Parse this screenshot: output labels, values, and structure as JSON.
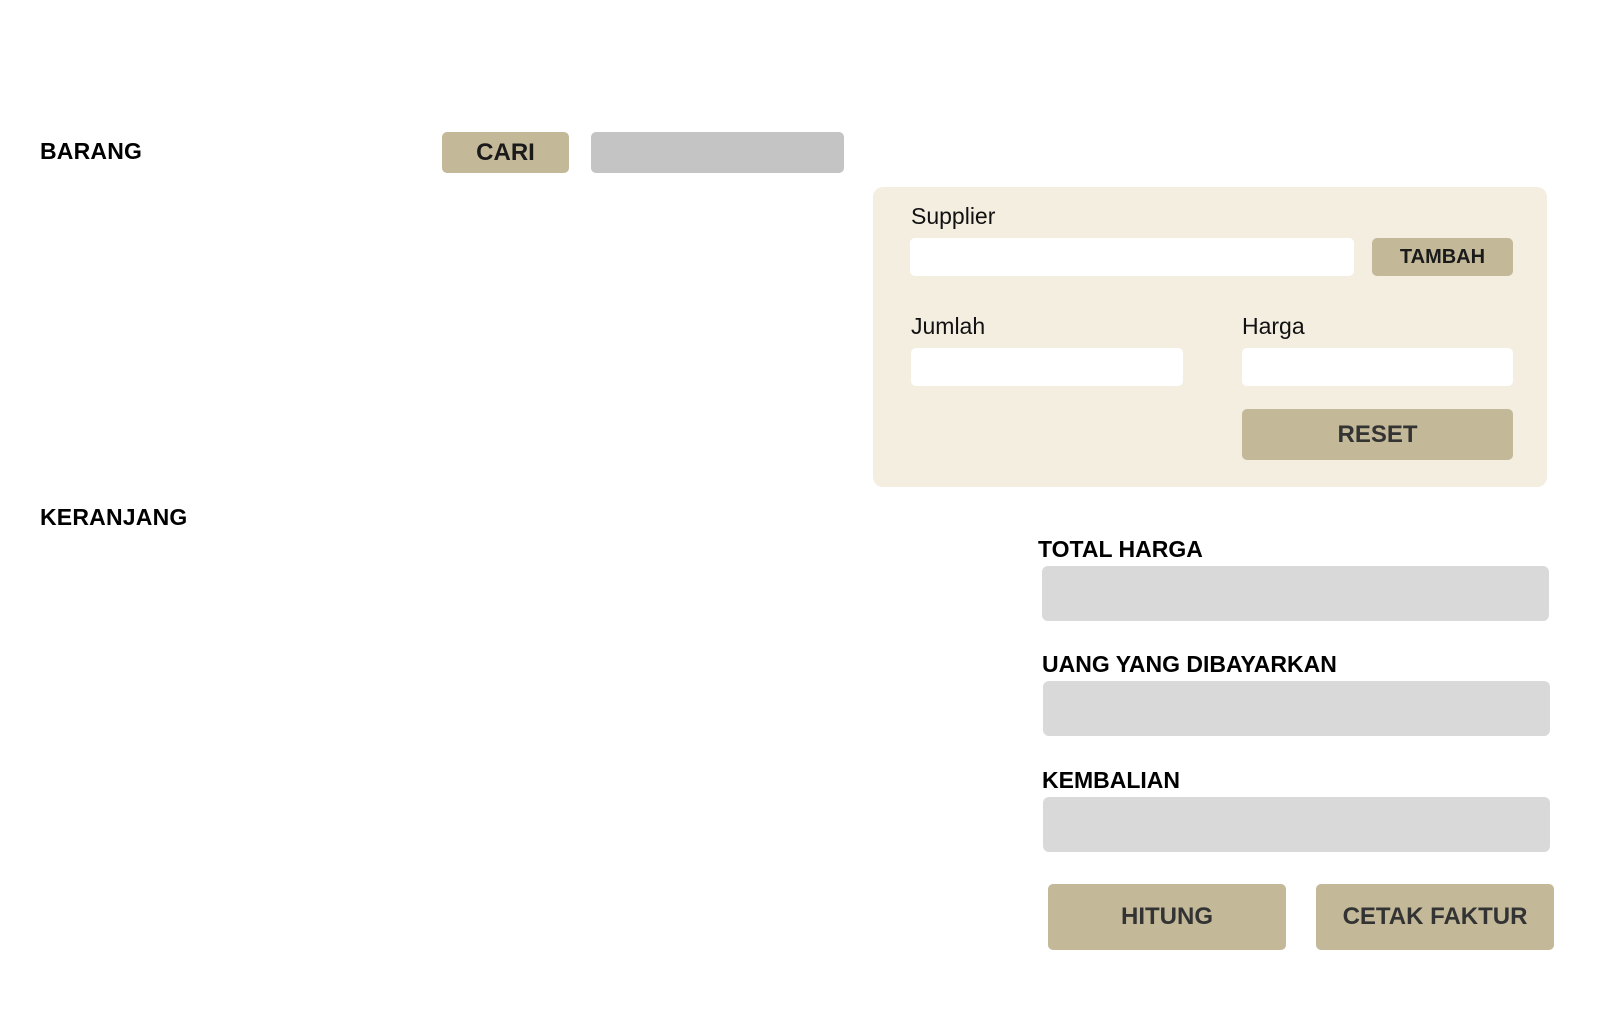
{
  "barang": {
    "title": "BARANG",
    "search_button": "CARI",
    "search_value": ""
  },
  "form": {
    "supplier_label": "Supplier",
    "supplier_value": "",
    "add_button": "TAMBAH",
    "jumlah_label": "Jumlah",
    "jumlah_value": "",
    "harga_label": "Harga",
    "harga_value": "",
    "reset_button": "RESET"
  },
  "keranjang": {
    "title": "KERANJANG"
  },
  "payment": {
    "total_label": "TOTAL HARGA",
    "total_value": "",
    "paid_label": "UANG YANG DIBAYARKAN",
    "paid_value": "",
    "change_label": "KEMBALIAN",
    "change_value": "",
    "calculate_button": "HITUNG",
    "print_button": "CETAK FAKTUR"
  },
  "colors": {
    "button": "#c3b999",
    "panel": "#f4eee1",
    "search_box": "#c4c4c4",
    "readonly_field": "#d9d9d9"
  }
}
